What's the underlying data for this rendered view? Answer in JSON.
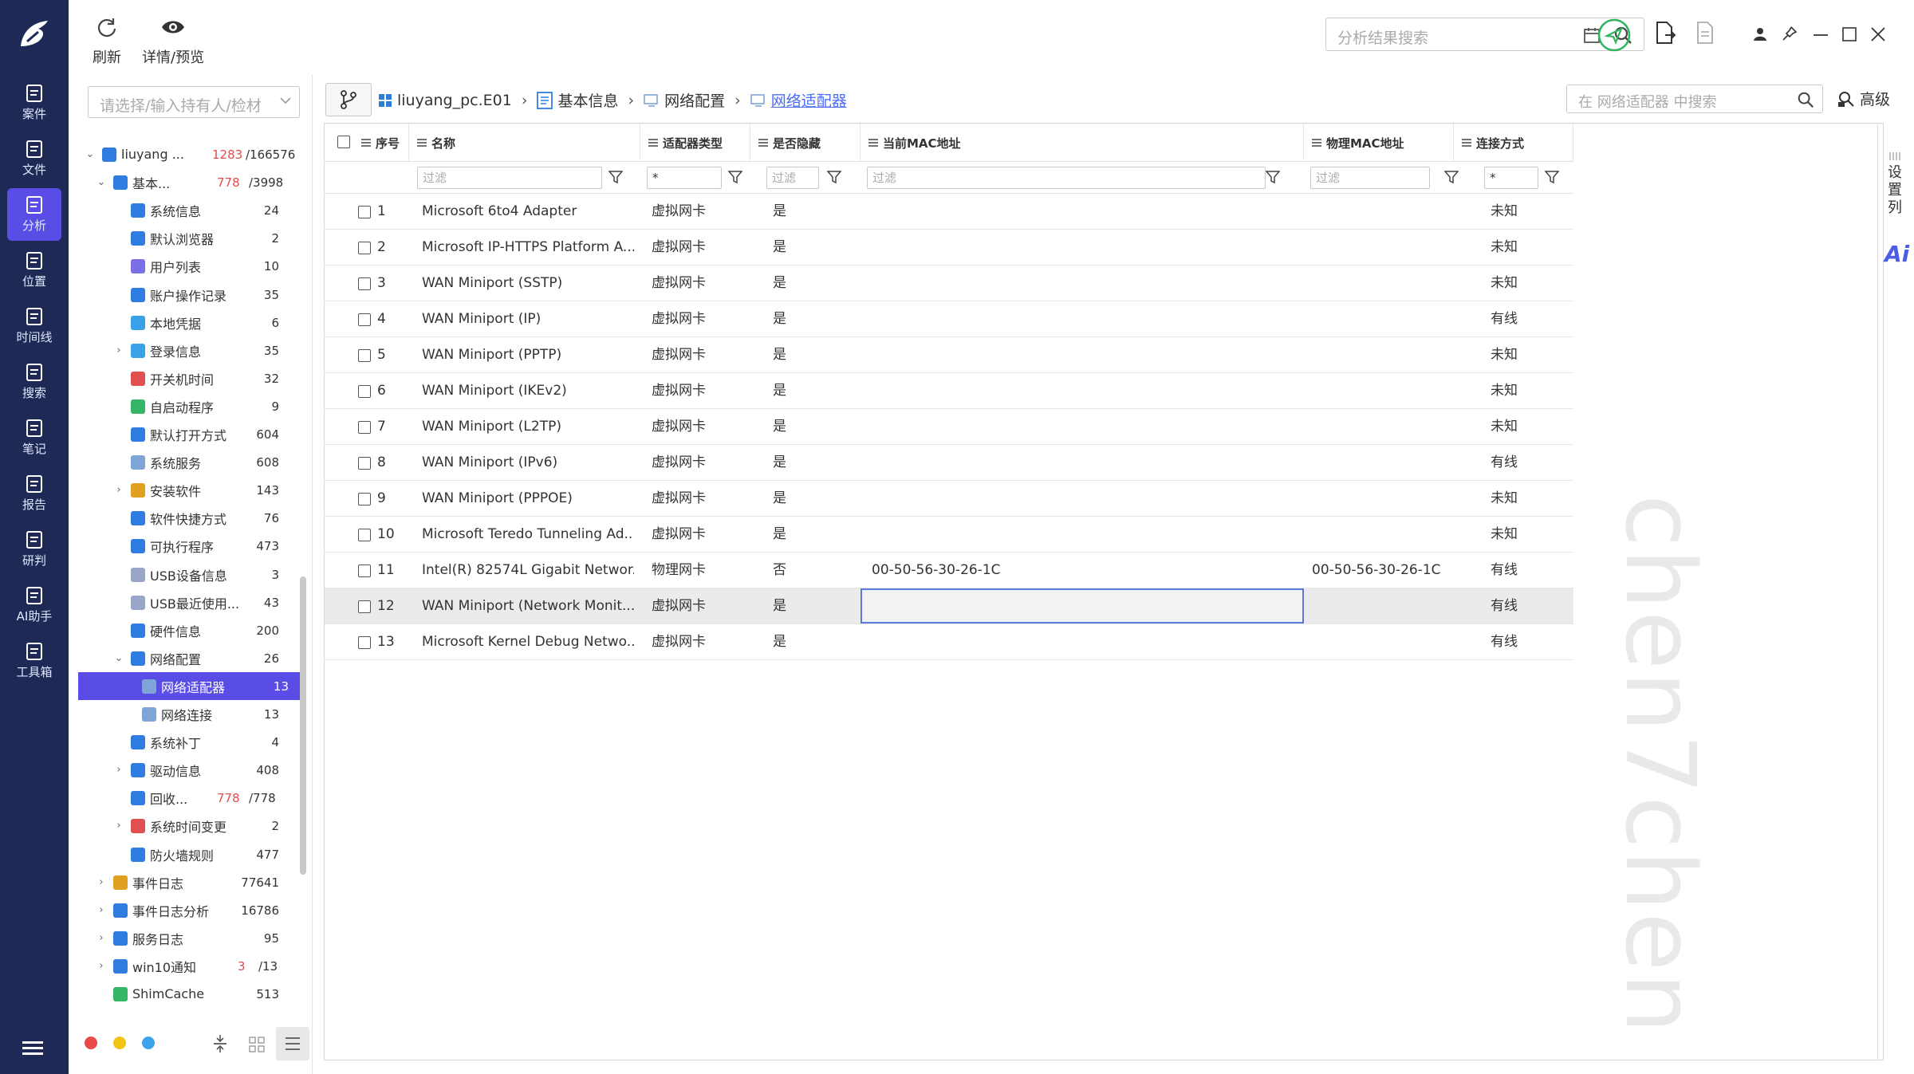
{
  "toolbar": {
    "refresh_label": "刷新",
    "detail_label": "详情/预览",
    "search_placeholder": "分析结果搜索"
  },
  "rail": {
    "items": [
      {
        "label": "案件",
        "icon": "case-icon"
      },
      {
        "label": "文件",
        "icon": "file-icon"
      },
      {
        "label": "分析",
        "icon": "analysis-icon"
      },
      {
        "label": "位置",
        "icon": "location-icon"
      },
      {
        "label": "时间线",
        "icon": "timeline-icon"
      },
      {
        "label": "搜索",
        "icon": "search-icon"
      },
      {
        "label": "笔记",
        "icon": "note-icon"
      },
      {
        "label": "报告",
        "icon": "report-icon"
      },
      {
        "label": "研判",
        "icon": "judge-icon"
      },
      {
        "label": "AI助手",
        "icon": "ai-assistant-icon"
      },
      {
        "label": "工具箱",
        "icon": "toolbox-icon"
      }
    ],
    "active_index": 2
  },
  "left": {
    "holder_placeholder": "请选择/输入持有人/检材",
    "tree": [
      {
        "label": "liuyang ...",
        "count": "1283",
        "total": "/166576",
        "level": 0,
        "exp": "v",
        "color": "#2f7de1"
      },
      {
        "label": "基本...",
        "count": "778",
        "total": "/3998",
        "level": 1,
        "exp": "v",
        "color": "#2f7de1"
      },
      {
        "label": "系统信息",
        "count": "24",
        "level": 2,
        "color": "#2f7de1"
      },
      {
        "label": "默认浏览器",
        "count": "2",
        "level": 2,
        "color": "#2f7de1"
      },
      {
        "label": "用户列表",
        "count": "10",
        "level": 2,
        "color": "#7b6fe8"
      },
      {
        "label": "账户操作记录",
        "count": "35",
        "level": 2,
        "color": "#2f7de1"
      },
      {
        "label": "本地凭据",
        "count": "6",
        "level": 2,
        "color": "#3aa0e8"
      },
      {
        "label": "登录信息",
        "count": "35",
        "level": 2,
        "exp": ">",
        "color": "#3aa0e8"
      },
      {
        "label": "开关机时间",
        "count": "32",
        "level": 2,
        "color": "#e05050"
      },
      {
        "label": "自启动程序",
        "count": "9",
        "level": 2,
        "color": "#35b566"
      },
      {
        "label": "默认打开方式",
        "count": "604",
        "level": 2,
        "color": "#2f7de1"
      },
      {
        "label": "系统服务",
        "count": "608",
        "level": 2,
        "color": "#7fa4d8"
      },
      {
        "label": "安装软件",
        "count": "143",
        "level": 2,
        "exp": ">",
        "color": "#e0a020"
      },
      {
        "label": "软件快捷方式",
        "count": "76",
        "level": 2,
        "color": "#2f7de1"
      },
      {
        "label": "可执行程序",
        "count": "473",
        "level": 2,
        "color": "#2f7de1"
      },
      {
        "label": "USB设备信息",
        "count": "3",
        "level": 2,
        "color": "#9aa6c8"
      },
      {
        "label": "USB最近使用...",
        "count": "43",
        "level": 2,
        "color": "#9aa6c8"
      },
      {
        "label": "硬件信息",
        "count": "200",
        "level": 2,
        "color": "#2f7de1"
      },
      {
        "label": "网络配置",
        "count": "26",
        "level": 2,
        "exp": "v",
        "color": "#2f7de1"
      },
      {
        "label": "网络适配器",
        "count": "13",
        "level": 3,
        "color": "#7fa4d8"
      },
      {
        "label": "网络连接",
        "count": "13",
        "level": 3,
        "color": "#7fa4d8"
      },
      {
        "label": "系统补丁",
        "count": "4",
        "level": 2,
        "color": "#2f7de1"
      },
      {
        "label": "驱动信息",
        "count": "408",
        "level": 2,
        "exp": ">",
        "color": "#2f7de1"
      },
      {
        "label": "回收...",
        "count": "778",
        "total": "/778",
        "level": 2,
        "color": "#2f7de1"
      },
      {
        "label": "系统时间变更",
        "count": "2",
        "level": 2,
        "exp": ">",
        "color": "#e05050"
      },
      {
        "label": "防火墙规则",
        "count": "477",
        "level": 2,
        "color": "#2f7de1"
      },
      {
        "label": "事件日志",
        "count": "77641",
        "level": 1,
        "exp": ">",
        "color": "#e0a020"
      },
      {
        "label": "事件日志分析",
        "count": "16786",
        "level": 1,
        "exp": ">",
        "color": "#2f7de1"
      },
      {
        "label": "服务日志",
        "count": "95",
        "level": 1,
        "exp": ">",
        "color": "#2f7de1"
      },
      {
        "label": "win10通知",
        "count": "3",
        "total": "/13",
        "level": 1,
        "exp": ">",
        "color": "#2f7de1"
      },
      {
        "label": "ShimCache",
        "count": "513",
        "level": 1,
        "color": "#35b566"
      }
    ],
    "selected_index": 19
  },
  "crumbs": {
    "items": [
      "liuyang_pc.E01",
      "基本信息",
      "网络配置",
      "网络适配器"
    ],
    "search_placeholder": "在 网络适配器 中搜索",
    "advanced_label": "高级"
  },
  "grid": {
    "columns": [
      "序号",
      "名称",
      "适配器类型",
      "是否隐藏",
      "当前MAC地址",
      "物理MAC地址",
      "连接方式"
    ],
    "filter_placeholder": "过滤",
    "filter_star": "*",
    "rows": [
      {
        "no": "1",
        "name": "Microsoft 6to4 Adapter",
        "type": "虚拟网卡",
        "hidden": "是",
        "cur_mac": "",
        "phy_mac": "",
        "conn": "未知"
      },
      {
        "no": "2",
        "name": "Microsoft IP-HTTPS Platform A...",
        "type": "虚拟网卡",
        "hidden": "是",
        "cur_mac": "",
        "phy_mac": "",
        "conn": "未知"
      },
      {
        "no": "3",
        "name": "WAN Miniport (SSTP)",
        "type": "虚拟网卡",
        "hidden": "是",
        "cur_mac": "",
        "phy_mac": "",
        "conn": "未知"
      },
      {
        "no": "4",
        "name": "WAN Miniport (IP)",
        "type": "虚拟网卡",
        "hidden": "是",
        "cur_mac": "",
        "phy_mac": "",
        "conn": "有线"
      },
      {
        "no": "5",
        "name": "WAN Miniport (PPTP)",
        "type": "虚拟网卡",
        "hidden": "是",
        "cur_mac": "",
        "phy_mac": "",
        "conn": "未知"
      },
      {
        "no": "6",
        "name": "WAN Miniport (IKEv2)",
        "type": "虚拟网卡",
        "hidden": "是",
        "cur_mac": "",
        "phy_mac": "",
        "conn": "未知"
      },
      {
        "no": "7",
        "name": "WAN Miniport (L2TP)",
        "type": "虚拟网卡",
        "hidden": "是",
        "cur_mac": "",
        "phy_mac": "",
        "conn": "未知"
      },
      {
        "no": "8",
        "name": "WAN Miniport (IPv6)",
        "type": "虚拟网卡",
        "hidden": "是",
        "cur_mac": "",
        "phy_mac": "",
        "conn": "有线"
      },
      {
        "no": "9",
        "name": "WAN Miniport (PPPOE)",
        "type": "虚拟网卡",
        "hidden": "是",
        "cur_mac": "",
        "phy_mac": "",
        "conn": "未知"
      },
      {
        "no": "10",
        "name": "Microsoft Teredo Tunneling Ad...",
        "type": "虚拟网卡",
        "hidden": "是",
        "cur_mac": "",
        "phy_mac": "",
        "conn": "未知"
      },
      {
        "no": "11",
        "name": "Intel(R) 82574L Gigabit Networ...",
        "type": "物理网卡",
        "hidden": "否",
        "cur_mac": "00-50-56-30-26-1C",
        "phy_mac": "00-50-56-30-26-1C",
        "conn": "有线"
      },
      {
        "no": "12",
        "name": "WAN Miniport (Network Monit...",
        "type": "虚拟网卡",
        "hidden": "是",
        "cur_mac": "",
        "phy_mac": "",
        "conn": "有线"
      },
      {
        "no": "13",
        "name": "Microsoft Kernel Debug Netwo...",
        "type": "虚拟网卡",
        "hidden": "是",
        "cur_mac": "",
        "phy_mac": "",
        "conn": "有线"
      }
    ],
    "highlight_row": 11
  },
  "right": {
    "settings_cols_label": "设置列",
    "ai_label": "Ai"
  },
  "watermark": "chen7chen",
  "colors": {
    "rail": "#1e2a55",
    "accent": "#5a4de6",
    "link": "#4a6cf7",
    "count_red": "#e24c4c"
  }
}
